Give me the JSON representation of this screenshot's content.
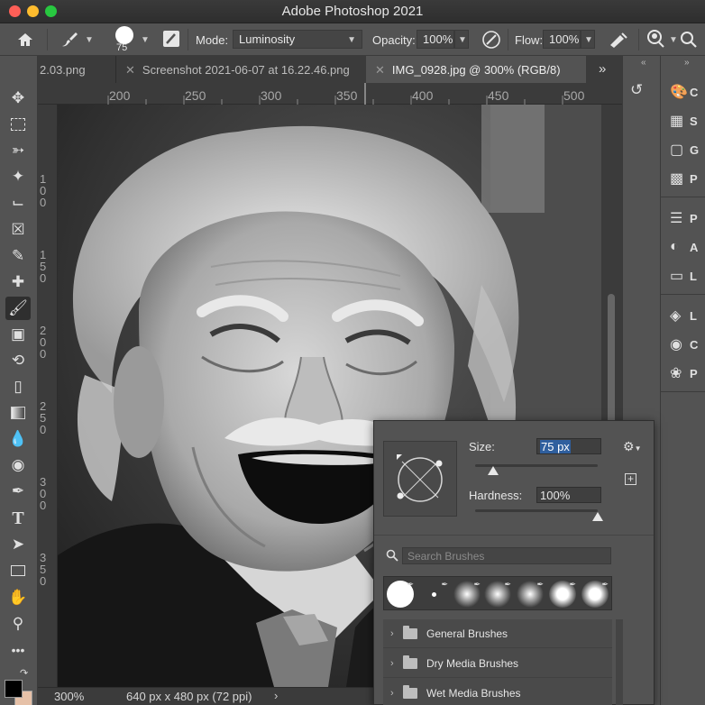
{
  "window": {
    "title": "Adobe Photoshop 2021"
  },
  "options_bar": {
    "brush_size": "75",
    "mode_label": "Mode:",
    "mode_value": "Luminosity",
    "opacity_label": "Opacity:",
    "opacity_value": "100%",
    "flow_label": "Flow:",
    "flow_value": "100%"
  },
  "tabs": [
    {
      "label": "2.03.png"
    },
    {
      "label": "Screenshot 2021-06-07 at 16.22.46.png"
    },
    {
      "label": "IMG_0928.jpg @ 300% (RGB/8)"
    }
  ],
  "ruler": {
    "top_ticks": [
      "200",
      "250",
      "300",
      "350",
      "400",
      "450",
      "500"
    ],
    "left_ticks": [
      "1\n0\n0",
      "1\n5\n0",
      "2\n0\n0",
      "2\n5\n0",
      "3\n0\n0",
      "3\n5\n0"
    ]
  },
  "status_bar": {
    "zoom": "300%",
    "doc_info": "640 px x 480 px (72 ppi)"
  },
  "brush_popup": {
    "size_label": "Size:",
    "size_value": "75 px",
    "size_level": 0.15,
    "hardness_label": "Hardness:",
    "hardness_value": "100%",
    "hardness_level": 1.0,
    "search_placeholder": "Search Brushes",
    "folders": [
      {
        "label": "General Brushes"
      },
      {
        "label": "Dry Media Brushes"
      },
      {
        "label": "Wet Media Brushes"
      }
    ]
  },
  "panels": [
    {
      "icon": "color-wheel-icon",
      "label": "C"
    },
    {
      "icon": "swatches-icon",
      "label": "S"
    },
    {
      "icon": "gradients-icon",
      "label": "G"
    },
    {
      "icon": "patterns-icon",
      "label": "P"
    },
    {
      "icon": "properties-icon",
      "label": "P"
    },
    {
      "icon": "adjustments-icon",
      "label": "A"
    },
    {
      "icon": "libraries-icon",
      "label": "L"
    },
    {
      "icon": "layers-icon",
      "label": "L"
    },
    {
      "icon": "channels-icon",
      "label": "C"
    },
    {
      "icon": "paths-icon",
      "label": "P"
    }
  ],
  "colors": {
    "foreground": "#000000",
    "background": "#e6c1a8",
    "accent_selection": "#2f5f9e"
  }
}
